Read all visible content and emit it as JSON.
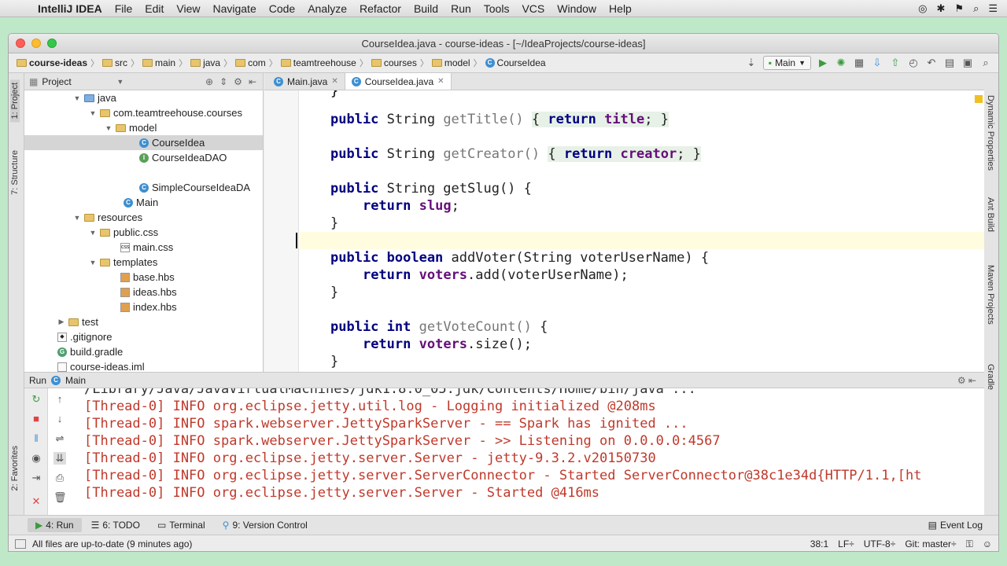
{
  "macos": {
    "apple": "",
    "app_name": "IntelliJ IDEA",
    "menu": [
      "File",
      "Edit",
      "View",
      "Navigate",
      "Code",
      "Analyze",
      "Refactor",
      "Build",
      "Run",
      "Tools",
      "VCS",
      "Window",
      "Help"
    ]
  },
  "window": {
    "title": "CourseIdea.java - course-ideas - [~/IdeaProjects/course-ideas]"
  },
  "breadcrumbs": [
    "course-ideas",
    "src",
    "main",
    "java",
    "com",
    "teamtreehouse",
    "courses",
    "model",
    "CourseIdea"
  ],
  "run_config": "Main",
  "project_panel": {
    "title": "Project",
    "tree": [
      {
        "label": "java"
      },
      {
        "label": "com.teamtreehouse.courses"
      },
      {
        "label": "model"
      },
      {
        "label": "CourseIdea"
      },
      {
        "label": "CourseIdeaDAO"
      },
      {
        "label": "SimpleCourseIdeaDA"
      },
      {
        "label": "Main"
      },
      {
        "label": "resources"
      },
      {
        "label": "public.css"
      },
      {
        "label": "main.css"
      },
      {
        "label": "templates"
      },
      {
        "label": "base.hbs"
      },
      {
        "label": "ideas.hbs"
      },
      {
        "label": "index.hbs"
      },
      {
        "label": "test"
      },
      {
        "label": ".gitignore"
      },
      {
        "label": "build.gradle"
      },
      {
        "label": "course-ideas.iml"
      }
    ]
  },
  "left_strip": {
    "project": "1: Project",
    "structure": "7: Structure",
    "favorites": "2: Favorites"
  },
  "right_strip": {
    "dynamic": "Dynamic Properties",
    "ant": "Ant Build",
    "maven": "Maven Projects",
    "gradle": "Gradle"
  },
  "editor": {
    "tabs": [
      {
        "label": "Main.java"
      },
      {
        "label": "CourseIdea.java"
      }
    ]
  },
  "run_panel": {
    "label": "Run",
    "config": "Main",
    "partial_line": "/Library/Java/JavaVirtualMachines/jdk1.8.0_05.jdk/Contents/Home/bin/java ...",
    "lines": [
      "[Thread-0] INFO org.eclipse.jetty.util.log - Logging initialized @208ms",
      "[Thread-0] INFO spark.webserver.JettySparkServer - == Spark has ignited ...",
      "[Thread-0] INFO spark.webserver.JettySparkServer - >> Listening on 0.0.0.0:4567",
      "[Thread-0] INFO org.eclipse.jetty.server.Server - jetty-9.3.2.v20150730",
      "[Thread-0] INFO org.eclipse.jetty.server.ServerConnector - Started ServerConnector@38c1e34d{HTTP/1.1,[ht",
      "[Thread-0] INFO org.eclipse.jetty.server.Server - Started @416ms"
    ]
  },
  "tool_windows": {
    "run": "4: Run",
    "todo": "6: TODO",
    "terminal": "Terminal",
    "vcs": "9: Version Control",
    "event_log": "Event Log"
  },
  "status": {
    "message": "All files are up-to-date (9 minutes ago)",
    "position": "38:1",
    "line_sep": "LF÷",
    "encoding": "UTF-8÷",
    "git": "Git: master÷"
  },
  "colors": {
    "accent_green": "#3c9c3c",
    "keyword": "#000080",
    "field": "#660e7a",
    "console_red": "#c0392b"
  }
}
